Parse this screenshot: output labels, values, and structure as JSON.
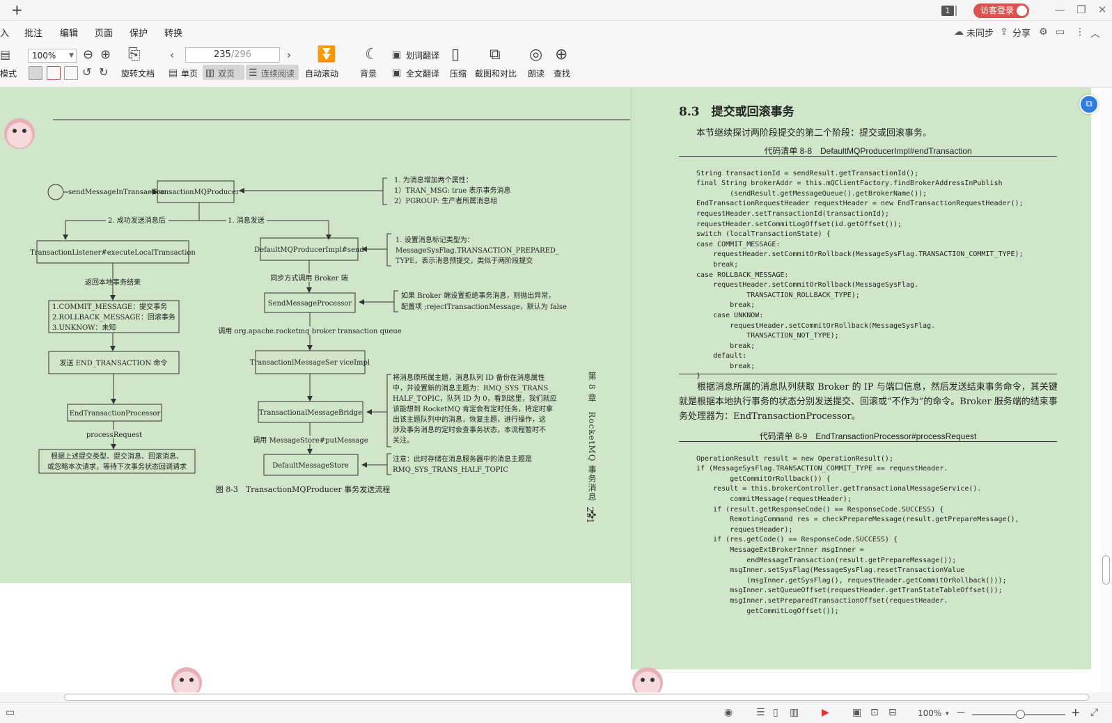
{
  "titlebar": {
    "new_tab": "+",
    "badge": "1",
    "login_label": "访客登录",
    "minimize": "—",
    "restore": "❐",
    "close": "✕"
  },
  "menu": {
    "items": [
      "入",
      "批注",
      "编辑",
      "页面",
      "保护",
      "转换"
    ],
    "sync_label": "未同步",
    "share_label": "分享"
  },
  "toolbar": {
    "mode_label": "模式",
    "zoom_value": "100%",
    "rotate_label": "旋转文档",
    "page_current": "235",
    "page_total": "/296",
    "single_label": "单页",
    "double_label": "双页",
    "continuous_label": "连续阅读",
    "autoscroll_label": "自动滚动",
    "background_label": "背景",
    "word_translate_label": "划词翻译",
    "full_translate_label": "全文翻译",
    "compress_label": "压缩",
    "screenshot_label": "截图和对比",
    "read_label": "朗读",
    "find_label": "查找"
  },
  "diagram": {
    "start_label": "sendMessageInTransaction",
    "producer": "TransactionMQProducer",
    "note1": [
      "1. 为消息增加两个属性：",
      "1）TRAN_MSG: true 表示事务消息",
      "2）PGROUP: 生产者所属消息组"
    ],
    "branch_left": "2. 成功发送消息后",
    "branch_right": "1. 消息发送",
    "listener": "TransactionListener#executeLocalTransaction",
    "return_label": "返回本地事务结果",
    "results": [
      "1.COMMIT_MESSAGE：提交事务",
      "2.ROLLBACK_MESSAGE：回滚事务",
      "3.UNKNOW：未知"
    ],
    "send_end": "发送 END_TRANSACTION 命令",
    "end_processor": "EndTransactionProcessor",
    "process_request": "processRequest",
    "final_box": [
      "根据上述提交类型、提交消息、回滚消息、",
      "或忽略本次请求，等待下次事务状态回调请求"
    ],
    "producer_impl": "DefaultMQProducerImpl#send",
    "note2": [
      "1. 设置消息标记类型为：",
      "MessageSysFlag.TRANSACTION_PREPARED_",
      "TYPE，表示消息预提交，类似于两阶段提交"
    ],
    "sync_broker": "同步方式调用 Broker 端",
    "send_processor": "SendMessageProcessor",
    "note3": [
      "如果 Broker 端设置拒绝事务消息，则抛出异常，",
      "配置项 ;rejectTransactionMessage，默认为 false"
    ],
    "call_queue": "调用 org.apache.rocketmq broker transaction queue",
    "service_impl": "TransactionlMessageSer viceImpl",
    "bridge": "TransactionalMessageBridge",
    "note4": [
      "将消息原所属主题，消息队列 ID 备份在消息属性",
      "中，并设置新的消息主题为：RMQ_SYS_TRANS_",
      "HALF_TOPIC，队列 ID 为 0，看到这里，我们就应",
      "该能想到 RocketMQ 肯定会有定时任务，将定时拿",
      "出该主题队列中的消息，恢复主题，进行操作，这",
      "涉及事务消息的定时会查事务状态，本流程暂时不",
      "关注。"
    ],
    "put_message": "调用 MessageStore#putMessage",
    "store": "DefaultMessageStore",
    "note5": [
      "注意：此时存储在消息服务器中的消息主题是",
      "RMQ_SYS_TRANS_HALF_TOPIC"
    ],
    "figure_caption": "图 8-3　TransactionMQProducer 事务发送流程",
    "side_label": "第 8 章　RocketMQ 事务消息　❖",
    "page_number": "231"
  },
  "right_page": {
    "heading": "8.3　提交或回滚事务",
    "intro": "本节继续探讨两阶段提交的第二个阶段：提交或回滚事务。",
    "listing1_caption": "代码清单 8-8　DefaultMQProducerImpl#endTransaction",
    "listing1": [
      "String transactionId = sendResult.getTransactionId();",
      "final String brokerAddr = this.mQClientFactory.findBrokerAddressInPublish",
      "        (sendResult.getMessageQueue().getBrokerName());",
      "EndTransactionRequestHeader requestHeader = new EndTransactionRequestHeader();",
      "requestHeader.setTransactionId(transactionId);",
      "requestHeader.setCommitLogOffset(id.getOffset());",
      "switch (localTransactionState) {",
      "case COMMIT_MESSAGE:",
      "    requestHeader.setCommitOrRollback(MessageSysFlag.TRANSACTION_COMMIT_TYPE);",
      "    break;",
      "case ROLLBACK_MESSAGE:",
      "    requestHeader.setCommitOrRollback(MessageSysFlag.",
      "            TRANSACTION_ROLLBACK_TYPE);",
      "        break;",
      "    case UNKNOW:",
      "        requestHeader.setCommitOrRollback(MessageSysFlag.",
      "            TRANSACTION_NOT_TYPE);",
      "        break;",
      "    default:",
      "        break;",
      "}"
    ],
    "para1": "根据消息所属的消息队列获取 Broker 的 IP 与端口信息，然后发送结束事务命令，其关键就是根据本地执行事务的状态分别发送提交、回滚或“不作为”的命令。Broker 服务端的结束事务处理器为：EndTransactionProcessor。",
    "listing2_caption": "代码清单 8-9　EndTransactionProcessor#processRequest",
    "listing2": [
      "OperationResult result = new OperationResult();",
      "if (MessageSysFlag.TRANSACTION_COMMIT_TYPE == requestHeader.",
      "        getCommitOrRollback()) {",
      "    result = this.brokerController.getTransactionalMessageService().",
      "        commitMessage(requestHeader);",
      "    if (result.getResponseCode() == ResponseCode.SUCCESS) {",
      "        RemotingCommand res = checkPrepareMessage(result.getPrepareMessage(),",
      "        requestHeader);",
      "    if (res.getCode() == ResponseCode.SUCCESS) {",
      "        MessageExtBrokerInner msgInner =",
      "            endMessageTransaction(result.getPrepareMessage());",
      "        msgInner.setSysFlag(MessageSysFlag.resetTransactionValue",
      "            (msgInner.getSysFlag(), requestHeader.getCommitOrRollback()));",
      "        msgInner.setQueueOffset(requestHeader.getTranStateTableOffset());",
      "        msgInner.setPreparedTransactionOffset(requestHeader.",
      "            getCommitLogOffset());"
    ]
  },
  "statusbar": {
    "zoom_value": "100%",
    "zoom_out": "—",
    "zoom_in": "+"
  }
}
